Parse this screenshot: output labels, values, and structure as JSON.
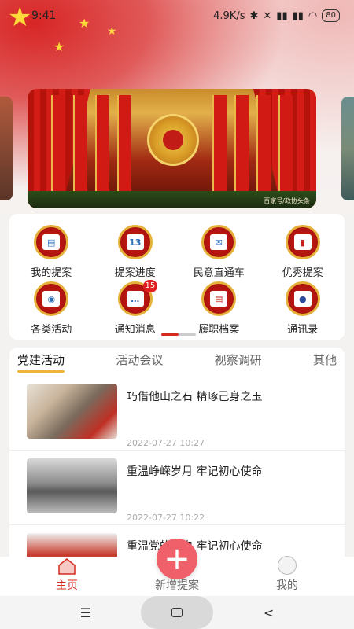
{
  "status_bar": {
    "time": "9:41",
    "network_speed": "4.9K/s",
    "battery": "80"
  },
  "banner": {
    "caption": "百家号/政协头条"
  },
  "menu": {
    "items": [
      {
        "label": "我的提案",
        "icon": "document-icon"
      },
      {
        "label": "提案进度",
        "icon": "calendar-icon"
      },
      {
        "label": "民意直通车",
        "icon": "mail-icon"
      },
      {
        "label": "优秀提案",
        "icon": "book-icon"
      },
      {
        "label": "各类活动",
        "icon": "camera-icon"
      },
      {
        "label": "通知消息",
        "icon": "chat-icon",
        "badge": "15"
      },
      {
        "label": "履职档案",
        "icon": "folder-icon"
      },
      {
        "label": "通讯录",
        "icon": "person-icon"
      }
    ]
  },
  "tabs": [
    "党建活动",
    "活动会议",
    "视察调研",
    "其他"
  ],
  "articles": [
    {
      "title": "巧借他山之石 精琢己身之玉",
      "time": "2022-07-27 10:27"
    },
    {
      "title": "重温峥嵘岁月 牢记初心使命",
      "time": "2022-07-27 10:22"
    },
    {
      "title": "重温党的历史 牢记初心使命",
      "time": ""
    }
  ],
  "bottom_nav": {
    "home": "主页",
    "add": "新增提案",
    "mine": "我的"
  },
  "colors": {
    "primary": "#d42a1e",
    "gold": "#e6b13a",
    "fab": "#f0606a"
  }
}
